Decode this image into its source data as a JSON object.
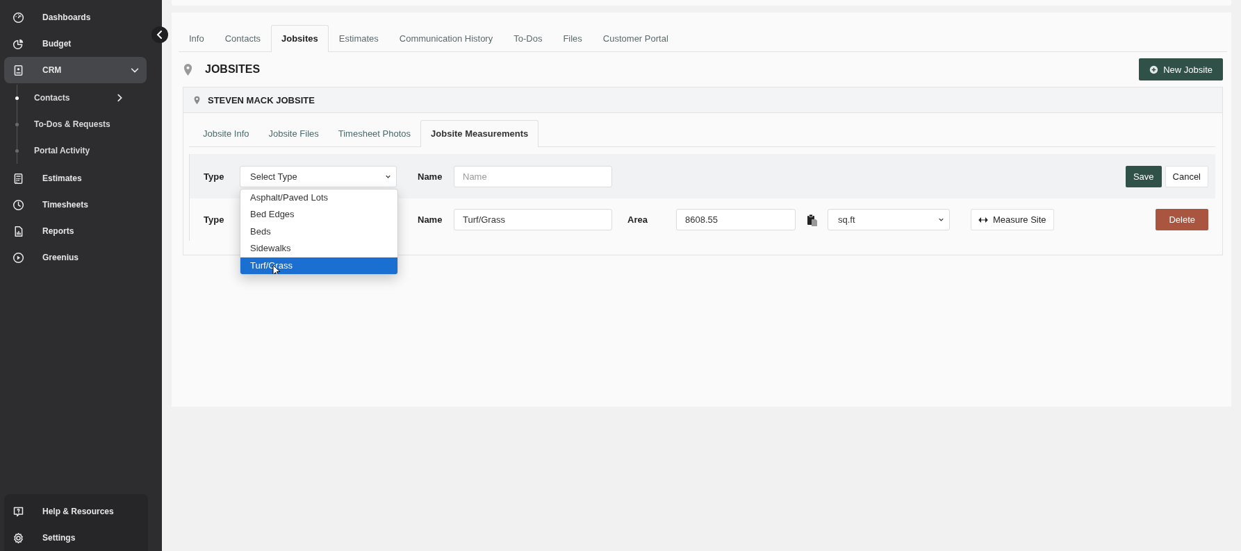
{
  "sidebar": {
    "items": [
      {
        "label": "Dashboards",
        "kind": "link",
        "selected": false
      },
      {
        "label": "Budget",
        "kind": "link",
        "selected": false
      },
      {
        "label": "CRM",
        "kind": "group",
        "selected": true,
        "expanded": true,
        "children": [
          {
            "label": "Contacts",
            "selected": true,
            "submenu": true
          },
          {
            "label": "To-Dos & Requests",
            "selected": false,
            "submenu": false
          },
          {
            "label": "Portal Activity",
            "selected": false,
            "submenu": false
          }
        ]
      },
      {
        "label": "Estimates",
        "kind": "link",
        "selected": false
      },
      {
        "label": "Timesheets",
        "kind": "link",
        "selected": false
      },
      {
        "label": "Reports",
        "kind": "link",
        "selected": false
      },
      {
        "label": "Greenius",
        "kind": "link",
        "selected": false
      }
    ],
    "footer_items": [
      {
        "label": "Help & Resources"
      },
      {
        "label": "Settings"
      }
    ]
  },
  "tabs": [
    {
      "label": "Info",
      "selected": false
    },
    {
      "label": "Contacts",
      "selected": false
    },
    {
      "label": "Jobsites",
      "selected": true
    },
    {
      "label": "Estimates",
      "selected": false
    },
    {
      "label": "Communication History",
      "selected": false
    },
    {
      "label": "To-Dos",
      "selected": false
    },
    {
      "label": "Files",
      "selected": false
    },
    {
      "label": "Customer Portal",
      "selected": false
    }
  ],
  "section": {
    "title": "JOBSITES",
    "new_button": "New Jobsite"
  },
  "jobsite": {
    "title": "STEVEN MACK JOBSITE",
    "tabs": [
      {
        "label": "Jobsite Info",
        "selected": false
      },
      {
        "label": "Jobsite Files",
        "selected": false
      },
      {
        "label": "Timesheet Photos",
        "selected": false
      },
      {
        "label": "Jobsite Measurements",
        "selected": true
      }
    ],
    "new_row": {
      "type_label": "Type",
      "type_placeholder": "Select Type",
      "name_label": "Name",
      "name_placeholder": "Name",
      "save": "Save",
      "cancel": "Cancel"
    },
    "type_options": [
      {
        "label": "Asphalt/Paved Lots",
        "selected": false
      },
      {
        "label": "Bed Edges",
        "selected": false
      },
      {
        "label": "Beds",
        "selected": false
      },
      {
        "label": "Sidewalks",
        "selected": false
      },
      {
        "label": "Turf/Grass",
        "selected": true
      }
    ],
    "measurements": [
      {
        "type_label": "Type",
        "name_label": "Name",
        "name": "Turf/Grass",
        "area_label": "Area",
        "area": "8608.55",
        "unit": "sq.ft",
        "measure_button": "Measure Site",
        "delete_button": "Delete"
      }
    ]
  }
}
